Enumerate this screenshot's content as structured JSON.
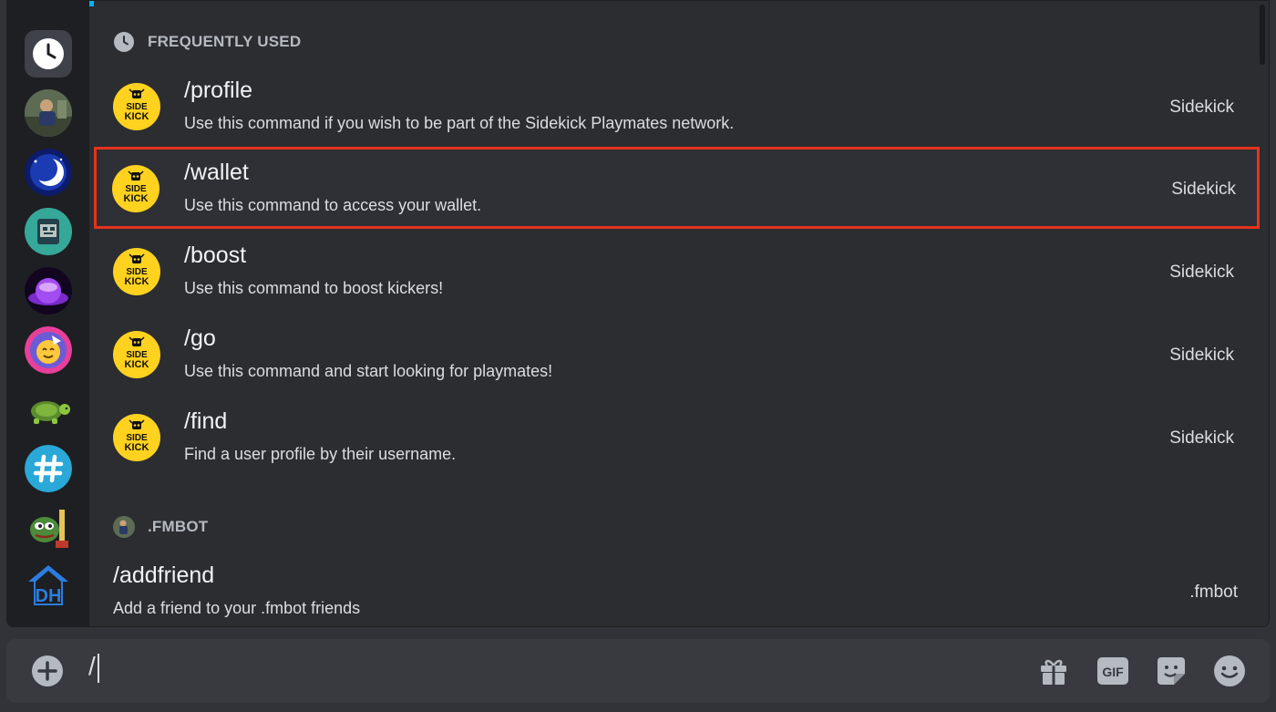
{
  "sections": {
    "frequent_title": "FREQUENTLY USED",
    "fmbot_title": ".FMBOT"
  },
  "commands": [
    {
      "name": "/profile",
      "desc": "Use this command if you wish to be part of the Sidekick Playmates network.",
      "source": "Sidekick"
    },
    {
      "name": "/wallet",
      "desc": "Use this command to access your wallet.",
      "source": "Sidekick"
    },
    {
      "name": "/boost",
      "desc": "Use this command to boost kickers!",
      "source": "Sidekick"
    },
    {
      "name": "/go",
      "desc": "Use this command and start looking for playmates!",
      "source": "Sidekick"
    },
    {
      "name": "/find",
      "desc": "Find a user profile by their username.",
      "source": "Sidekick"
    }
  ],
  "fmbot_commands": [
    {
      "name": "/addfriend",
      "desc": "Add a friend to your .fmbot friends",
      "source": ".fmbot"
    }
  ],
  "sidekick_logo": {
    "line1": "SIDE",
    "line2": "KICK"
  },
  "rail_icons": [
    "clock-icon",
    "server-photo",
    "moon-server",
    "robot-server",
    "purple-planet-server",
    "emoji-server",
    "turtle-server",
    "hashtag-server",
    "pepe-server",
    "dh-server"
  ],
  "composer": {
    "input_value": "/",
    "gif_label": "GIF"
  },
  "colors": {
    "highlight_border": "#e5331d",
    "sidekick_yellow": "#ffd21f",
    "accent": "#00b0f4"
  }
}
